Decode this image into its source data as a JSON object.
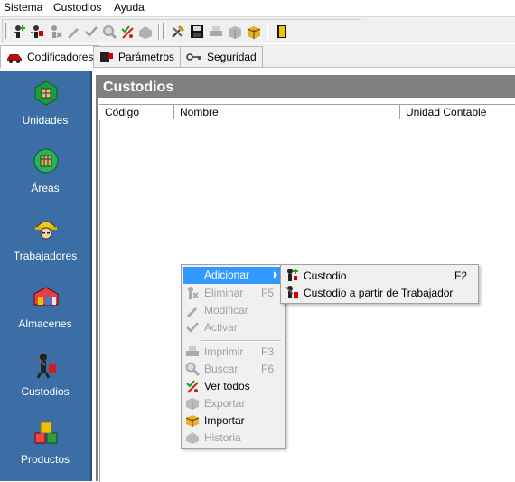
{
  "menubar": {
    "items": [
      "Sistema",
      "Custodios",
      "Ayuda"
    ]
  },
  "toolbar": {
    "buttons": [
      "custodian-add-icon",
      "custodian-from-worker-icon",
      "delete-icon",
      "edit-icon",
      "activate-icon",
      "search-icon",
      "view-all-icon",
      "history-icon",
      "tools-icon",
      "save-disk-icon",
      "print-icon",
      "export-icon",
      "import-icon",
      "exit-icon"
    ]
  },
  "tabs": [
    {
      "label": "Codificadores",
      "icon": "car-icon",
      "active": true
    },
    {
      "label": "Parámetros",
      "icon": "params-book-icon",
      "active": false
    },
    {
      "label": "Seguridad",
      "icon": "key-icon",
      "active": false
    }
  ],
  "leftnav": {
    "items": [
      {
        "label": "Unidades",
        "icon": "hexagon-box-icon"
      },
      {
        "label": "Áreas",
        "icon": "area-circle-icon"
      },
      {
        "label": "Trabajadores",
        "icon": "worker-helmet-icon"
      },
      {
        "label": "Almacenes",
        "icon": "warehouse-icon"
      },
      {
        "label": "Custodios",
        "icon": "custodian-icon"
      },
      {
        "label": "Productos",
        "icon": "products-boxes-icon"
      }
    ]
  },
  "main": {
    "title": "Custodios",
    "columns": [
      "Código",
      "Nombre",
      "Unidad Contable"
    ]
  },
  "context_menu": {
    "items": [
      {
        "label": "Adicionar",
        "shortcut": "",
        "disabled": false,
        "highlighted": true,
        "submenu": true,
        "icon": ""
      },
      {
        "label": "Eliminar",
        "shortcut": "F5",
        "disabled": true,
        "icon": "delete-icon"
      },
      {
        "label": "Modificar",
        "shortcut": "",
        "disabled": true,
        "icon": "edit-pencil-icon"
      },
      {
        "label": "Activar",
        "shortcut": "",
        "disabled": true,
        "icon": "checkmark-icon"
      },
      {
        "label": "Imprimir",
        "shortcut": "F3",
        "disabled": true,
        "icon": "printer-icon"
      },
      {
        "label": "Buscar",
        "shortcut": "F6",
        "disabled": true,
        "icon": "magnifier-icon"
      },
      {
        "label": "Ver todos",
        "shortcut": "",
        "disabled": false,
        "icon": "view-all-icon"
      },
      {
        "label": "Exportar",
        "shortcut": "",
        "disabled": true,
        "icon": "export-box-icon"
      },
      {
        "label": "Importar",
        "shortcut": "",
        "disabled": false,
        "icon": "import-box-icon"
      },
      {
        "label": "Historia",
        "shortcut": "",
        "disabled": true,
        "icon": "history-icon"
      }
    ]
  },
  "submenu": {
    "items": [
      {
        "label": "Custodio",
        "shortcut": "F2",
        "icon": "custodian-add-icon"
      },
      {
        "label": "Custodio a partir de Trabajador",
        "shortcut": "",
        "icon": "custodian-from-worker-icon"
      }
    ]
  },
  "colors": {
    "nav_bg": "#3a6ea5",
    "title_bar": "#808080",
    "highlight": "#3399ff"
  }
}
